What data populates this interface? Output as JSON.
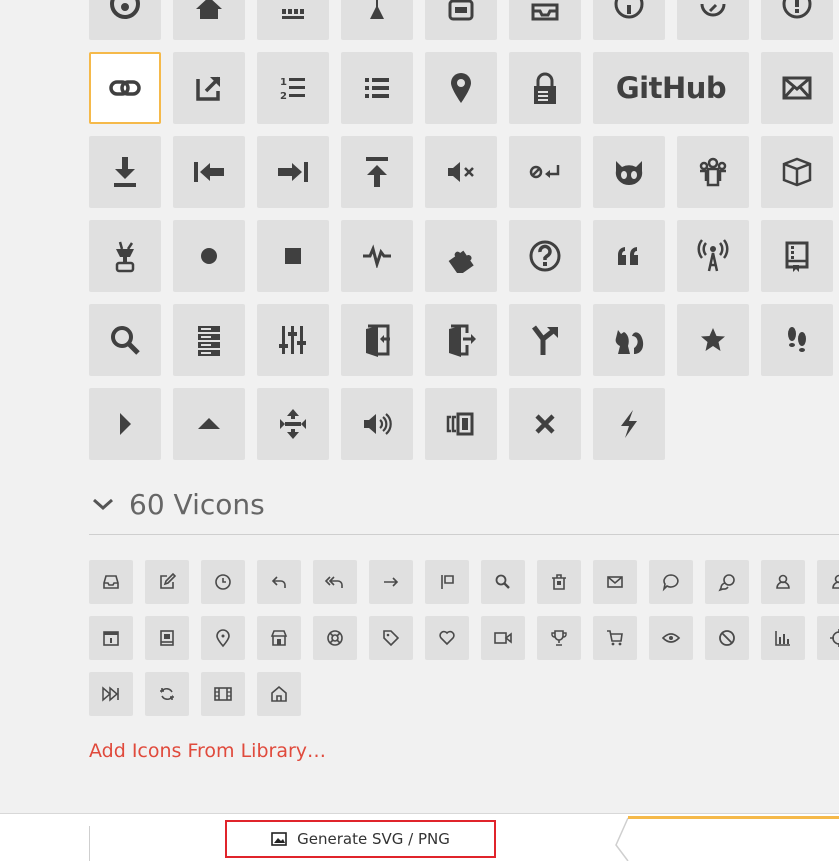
{
  "icon_grid": {
    "github_label": "GitHub",
    "tiles": [
      {
        "name": "github-circle-icon"
      },
      {
        "name": "home-icon"
      },
      {
        "name": "keyboard-icon"
      },
      {
        "name": "island-icon"
      },
      {
        "name": "robot-icon"
      },
      {
        "name": "inbox-icon"
      },
      {
        "name": "info-icon"
      },
      {
        "name": "issue-reopened-icon"
      },
      {
        "name": "alert-icon"
      },
      {
        "name": "link-icon",
        "selected": true
      },
      {
        "name": "link-external-icon"
      },
      {
        "name": "list-ordered-icon"
      },
      {
        "name": "list-unordered-icon"
      },
      {
        "name": "location-icon"
      },
      {
        "name": "lock-icon"
      },
      {
        "name": "logo-github-icon"
      },
      {
        "name": "mail-icon"
      },
      {
        "name": "download-icon"
      },
      {
        "name": "move-left-icon"
      },
      {
        "name": "move-right-icon"
      },
      {
        "name": "upload-icon"
      },
      {
        "name": "mute-icon"
      },
      {
        "name": "no-newline-icon"
      },
      {
        "name": "octoface-icon"
      },
      {
        "name": "organization-icon"
      },
      {
        "name": "package-icon"
      },
      {
        "name": "plug-icon"
      },
      {
        "name": "primitive-dot-icon"
      },
      {
        "name": "primitive-square-icon"
      },
      {
        "name": "pulse-icon"
      },
      {
        "name": "puzzle-icon"
      },
      {
        "name": "question-icon"
      },
      {
        "name": "quote-icon"
      },
      {
        "name": "broadcast-icon"
      },
      {
        "name": "repo-icon"
      },
      {
        "name": "search-icon"
      },
      {
        "name": "server-icon"
      },
      {
        "name": "settings-icon"
      },
      {
        "name": "sign-in-icon"
      },
      {
        "name": "sign-out-icon"
      },
      {
        "name": "git-merge-icon"
      },
      {
        "name": "squirrel-icon"
      },
      {
        "name": "star-icon"
      },
      {
        "name": "steps-icon"
      },
      {
        "name": "triangle-right-icon"
      },
      {
        "name": "triangle-up-icon"
      },
      {
        "name": "unfold-icon"
      },
      {
        "name": "unmute-icon"
      },
      {
        "name": "versions-icon"
      },
      {
        "name": "x-icon"
      },
      {
        "name": "zap-icon"
      }
    ]
  },
  "vicons_section": {
    "title": "60 Vicons",
    "icons": [
      "inbox-icon",
      "edit-icon",
      "clock-icon",
      "reply-icon",
      "reply-all-icon",
      "forward-icon",
      "flag-icon",
      "search-icon",
      "trash-icon",
      "mail-icon",
      "chat-icon",
      "chat-bubbles-icon",
      "user-icon",
      "users-icon",
      "calendar-icon",
      "book-icon",
      "location-icon",
      "shop-icon",
      "lifebuoy-icon",
      "tag-icon",
      "heart-icon",
      "video-icon",
      "trophy-icon",
      "cart-icon",
      "eye-icon",
      "forbidden-icon",
      "bar-chart-icon",
      "target-icon",
      "fast-forward-icon",
      "refresh-icon",
      "film-icon",
      "home-icon"
    ]
  },
  "add_icons_link": "Add Icons From Library…",
  "bottom_bar": {
    "generate_label": "Generate SVG / PNG",
    "accent": "#e0242b"
  },
  "colors": {
    "tile": "#e0e0e0",
    "icon": "#404040",
    "selected_border": "#f5b94a",
    "link": "#e04a3c"
  }
}
